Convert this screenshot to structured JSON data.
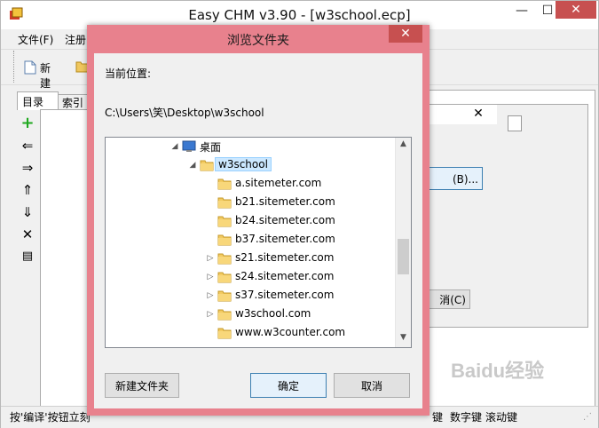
{
  "main": {
    "title": "Easy CHM v3.90 - [w3school.ecp]",
    "window_controls": {
      "minimize": "—",
      "maximize": "☐",
      "close": "✕"
    },
    "menu": [
      "文件(F)",
      "注册"
    ],
    "toolbar": {
      "new_label": "新建"
    },
    "left_tabs": [
      "目录",
      "索引"
    ],
    "statusbar_left": "按'编译'按钮立刻",
    "statusbar_right": [
      "键",
      "数字键",
      "滚动键"
    ]
  },
  "background_dialog": {
    "close": "✕",
    "browse_button_partial": "(B)...",
    "cancel_button_partial": "消(C)"
  },
  "browse_dialog": {
    "title": "浏览文件夹",
    "close": "✕",
    "current_location_label": "当前位置:",
    "current_path": "C:\\Users\\笑\\Desktop\\w3school",
    "tree": [
      {
        "label": "桌面",
        "expanded": true,
        "has_children": true,
        "level": 0,
        "icon": "desktop-icon"
      },
      {
        "label": "w3school",
        "expanded": true,
        "has_children": true,
        "level": 1,
        "selected": true,
        "icon": "folder-icon"
      },
      {
        "label": "a.sitemeter.com",
        "has_children": false,
        "level": 2,
        "icon": "folder-icon"
      },
      {
        "label": "b21.sitemeter.com",
        "has_children": false,
        "level": 2,
        "icon": "folder-icon"
      },
      {
        "label": "b24.sitemeter.com",
        "has_children": false,
        "level": 2,
        "icon": "folder-icon"
      },
      {
        "label": "b37.sitemeter.com",
        "has_children": false,
        "level": 2,
        "icon": "folder-icon"
      },
      {
        "label": "s21.sitemeter.com",
        "has_children": true,
        "level": 2,
        "icon": "folder-icon"
      },
      {
        "label": "s24.sitemeter.com",
        "has_children": true,
        "level": 2,
        "icon": "folder-icon"
      },
      {
        "label": "s37.sitemeter.com",
        "has_children": true,
        "level": 2,
        "icon": "folder-icon"
      },
      {
        "label": "w3school.com",
        "has_children": true,
        "level": 2,
        "icon": "folder-icon"
      },
      {
        "label": "www.w3counter.com",
        "has_children": false,
        "level": 2,
        "icon": "folder-icon"
      }
    ],
    "buttons": {
      "new_folder": "新建文件夹",
      "ok": "确定",
      "cancel": "取消"
    }
  },
  "watermark": "Baidu经验"
}
